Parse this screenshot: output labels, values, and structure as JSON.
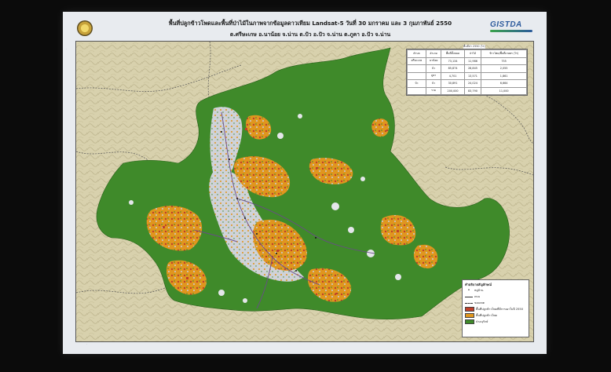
{
  "slide": {
    "title_line1": "พื้นที่ปลูกข้าวโพดและพื้นที่ป่าไม้ในภาพจากข้อมูลดาวเทียม Landsat-5 วันที่ 30 มกราคม และ 3 กุมภาพันธ์ 2550",
    "title_line2": "ต.ศรีษะเกษ อ.นาน้อย จ.น่าน ต.ปัว อ.ปัว จ.น่าน ต.ภูคา อ.ปัว จ.น่าน",
    "logo_text": "GISTDA"
  },
  "colors": {
    "forest": "#3f8a2a",
    "corn": "#e0961e",
    "corn_burnt": "#c0402a",
    "cleared": "#c8ccd4",
    "terrain": "#d8d1ad",
    "roads": "#6a4a8a"
  },
  "table": {
    "header_title": "พื้นที่ป่า 2550 (ไร่)",
    "col_headers": [
      "ตำบล",
      "อำเภอ",
      "พื้นที่ทั้งหมด",
      "ป่าไม้",
      "ข้าวโพด/พื้นที่เกษตร (ไร่)"
    ],
    "rows": [
      [
        "ศรีษะเกษ",
        "นาน้อย",
        "73,134",
        "11,986",
        "755"
      ],
      [
        "",
        "ปัว",
        "85,874",
        "28,845",
        "2,055"
      ],
      [
        "",
        "ภูคา",
        "4,701",
        "13,571",
        "1,861"
      ],
      [
        "ปัว",
        "ปัว",
        "30,891",
        "24,024",
        "6,664"
      ],
      [
        "",
        "รวม",
        "200,000",
        "83,790",
        "11,000"
      ]
    ]
  },
  "legend": {
    "title": "คำอธิบายสัญลักษณ์",
    "items": [
      {
        "kind": "dot",
        "label": "หมู่บ้าน"
      },
      {
        "kind": "line",
        "label": "ถนน"
      },
      {
        "kind": "line",
        "label": "ขอบเขต"
      },
      {
        "kind": "swatch",
        "color": "#c0402a",
        "label": "พื้นที่ปลูกข้าวโพดที่มีการเผาในปี 2550"
      },
      {
        "kind": "swatch",
        "color": "#e0961e",
        "label": "พื้นที่ปลูกข้าวโพด"
      },
      {
        "kind": "swatch",
        "color": "#3f8a2a",
        "label": "ป่าอนุรักษ์"
      }
    ]
  }
}
